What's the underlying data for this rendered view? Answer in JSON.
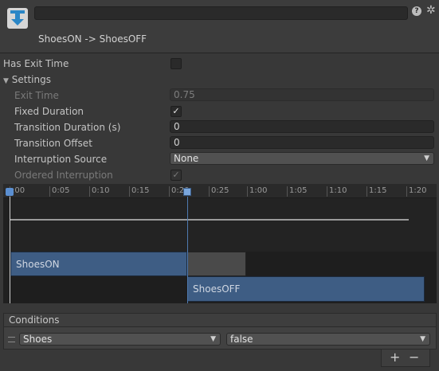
{
  "header": {
    "icon": "transition-arrow-down-icon",
    "name_field_value": "",
    "title": "ShoesON -> ShoesOFF",
    "help_icon": "?",
    "settings_icon": "✲"
  },
  "has_exit_time": {
    "label": "Has Exit Time",
    "checked": false
  },
  "settings": {
    "label": "Settings",
    "expanded": true,
    "exit_time": {
      "label": "Exit Time",
      "value": "0.75"
    },
    "fixed_duration": {
      "label": "Fixed Duration",
      "checked": true,
      "mark": "✓"
    },
    "transition_duration": {
      "label": "Transition Duration (s)",
      "value": "0"
    },
    "transition_offset": {
      "label": "Transition Offset",
      "value": "0"
    },
    "interruption_source": {
      "label": "Interruption Source",
      "value": "None"
    },
    "ordered_interruption": {
      "label": "Ordered Interruption",
      "checked": true,
      "mark": "✓"
    }
  },
  "timeline": {
    "ticks": [
      ":00",
      "0:05",
      "0:10",
      "0:15",
      "0:20",
      "0:25",
      "1:00",
      "1:05",
      "1:10",
      "1:15",
      "1:20"
    ],
    "source_clip": "ShoesON",
    "destination_clip": "ShoesOFF"
  },
  "conditions": {
    "label": "Conditions",
    "rows": [
      {
        "parameter": "Shoes",
        "value": "false"
      }
    ],
    "add_label": "+",
    "remove_label": "−"
  }
}
